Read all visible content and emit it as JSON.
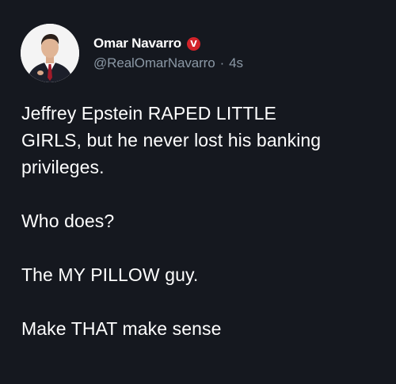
{
  "post": {
    "author": {
      "display_name": "Omar Navarro",
      "handle": "@RealOmarNavarro",
      "verified_badge_letter": "V",
      "avatar_icon": "profile-photo"
    },
    "meta": {
      "separator": "·",
      "time": "4s"
    },
    "body": {
      "line_1": "Jeffrey Epstein RAPED LITTLE",
      "line_2": "GIRLS, but he never lost his banking",
      "line_3": "privileges.",
      "line_4": "Who does?",
      "line_5": "The MY PILLOW guy.",
      "line_6": "Make THAT make sense"
    },
    "colors": {
      "background": "#15181f",
      "text_primary": "#ffffff",
      "text_secondary": "#8b98a5",
      "badge": "#d2232a"
    }
  }
}
